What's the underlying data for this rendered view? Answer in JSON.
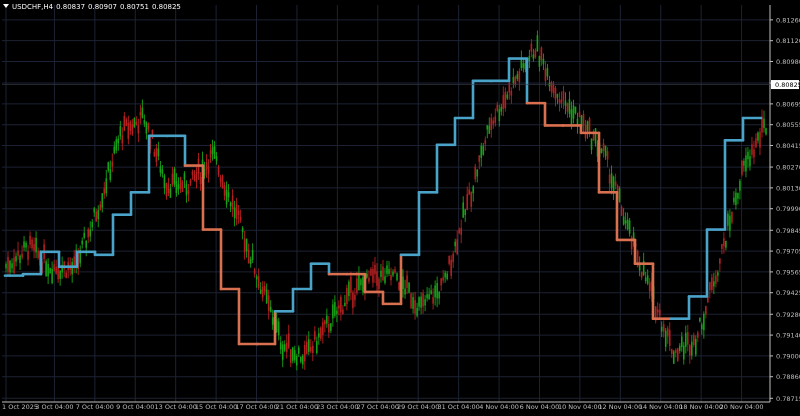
{
  "header": {
    "symbol": "USDCHF,H4",
    "open": "0.80837",
    "high": "0.80907",
    "low": "0.80751",
    "close": "0.80825"
  },
  "colors": {
    "background": "#000000",
    "grid": "#1c2233",
    "axis": "#bfbfbf",
    "bull_candle": "#17a317",
    "bear_candle": "#b52020",
    "trend_up": "#4aa3c9",
    "trend_down": "#d9704f",
    "price_label_bg": "#ffffff",
    "price_label_text": "#000000"
  },
  "chart_data": {
    "type": "candlestick",
    "y_ticks": [
      "0.81260",
      "0.81120",
      "0.80980",
      "0.80835",
      "0.80695",
      "0.80555",
      "0.80415",
      "0.80270",
      "0.80130",
      "0.79990",
      "0.79845",
      "0.79705",
      "0.79565",
      "0.79425",
      "0.79280",
      "0.79140",
      "0.79000",
      "0.78860",
      "0.78715"
    ],
    "ylim": [
      0.7869,
      0.8136
    ],
    "current_price": "0.80825",
    "x_labels": [
      "1 Oct 2025",
      "3 Oct 04:00",
      "7 Oct 04:00",
      "9 Oct 04:00",
      "13 Oct 04:00",
      "15 Oct 04:00",
      "17 Oct 04:00",
      "21 Oct 04:00",
      "23 Oct 04:00",
      "27 Oct 04:00",
      "29 Oct 04:00",
      "31 Oct 04:00",
      "4 Nov 04:00",
      "6 Nov 04:00",
      "10 Nov 04:00",
      "12 Nov 04:00",
      "14 Nov 04:00",
      "18 Nov 04:00",
      "20 Nov 04:00"
    ],
    "price_path": [
      [
        0.7954,
        0.7967
      ],
      [
        0.7968,
        0.7978
      ],
      [
        0.7965,
        0.7954
      ],
      [
        0.7948,
        0.797
      ],
      [
        0.799,
        0.801
      ],
      [
        0.804,
        0.806
      ],
      [
        0.807,
        0.805
      ],
      [
        0.803,
        0.8
      ],
      [
        0.799,
        0.804
      ],
      [
        0.8045,
        0.8025
      ],
      [
        0.801,
        0.798
      ],
      [
        0.796,
        0.794
      ],
      [
        0.792,
        0.7895
      ],
      [
        0.788,
        0.7918
      ],
      [
        0.7925,
        0.7918
      ],
      [
        0.793,
        0.7955
      ],
      [
        0.796,
        0.7945
      ],
      [
        0.7958,
        0.7948
      ],
      [
        0.794,
        0.7925
      ],
      [
        0.7935,
        0.796
      ],
      [
        0.799,
        0.801
      ],
      [
        0.805,
        0.806
      ],
      [
        0.808,
        0.8085
      ],
      [
        0.811,
        0.8105
      ],
      [
        0.809,
        0.806
      ],
      [
        0.8065,
        0.805
      ],
      [
        0.804,
        0.803
      ],
      [
        0.799,
        0.798
      ],
      [
        0.796,
        0.7925
      ],
      [
        0.792,
        0.7885
      ],
      [
        0.79,
        0.7925
      ],
      [
        0.795,
        0.798
      ],
      [
        0.801,
        0.804
      ],
      [
        0.805,
        0.806
      ]
    ],
    "trend_line": [
      [
        0.7954,
        "up"
      ],
      [
        0.7955,
        "up"
      ],
      [
        0.797,
        "up"
      ],
      [
        0.796,
        "up"
      ],
      [
        0.797,
        "up"
      ],
      [
        0.7968,
        "up"
      ],
      [
        0.7995,
        "up"
      ],
      [
        0.801,
        "up"
      ],
      [
        0.8048,
        "up"
      ],
      [
        0.8048,
        "up"
      ],
      [
        0.8028,
        "down"
      ],
      [
        0.7985,
        "down"
      ],
      [
        0.7945,
        "down"
      ],
      [
        0.7908,
        "down"
      ],
      [
        0.7908,
        "down"
      ],
      [
        0.793,
        "up"
      ],
      [
        0.7945,
        "up"
      ],
      [
        0.7962,
        "up"
      ],
      [
        0.7955,
        "down"
      ],
      [
        0.7955,
        "down"
      ],
      [
        0.7943,
        "down"
      ],
      [
        0.7935,
        "down"
      ],
      [
        0.7968,
        "up"
      ],
      [
        0.801,
        "up"
      ],
      [
        0.8042,
        "up"
      ],
      [
        0.806,
        "up"
      ],
      [
        0.8085,
        "up"
      ],
      [
        0.8085,
        "up"
      ],
      [
        0.81,
        "up"
      ],
      [
        0.807,
        "down"
      ],
      [
        0.8055,
        "down"
      ],
      [
        0.8055,
        "down"
      ],
      [
        0.805,
        "down"
      ],
      [
        0.801,
        "down"
      ],
      [
        0.7978,
        "down"
      ],
      [
        0.7962,
        "down"
      ],
      [
        0.7925,
        "down"
      ],
      [
        0.7925,
        "up"
      ],
      [
        0.794,
        "up"
      ],
      [
        0.7985,
        "up"
      ],
      [
        0.8045,
        "up"
      ],
      [
        0.806,
        "up"
      ]
    ]
  }
}
